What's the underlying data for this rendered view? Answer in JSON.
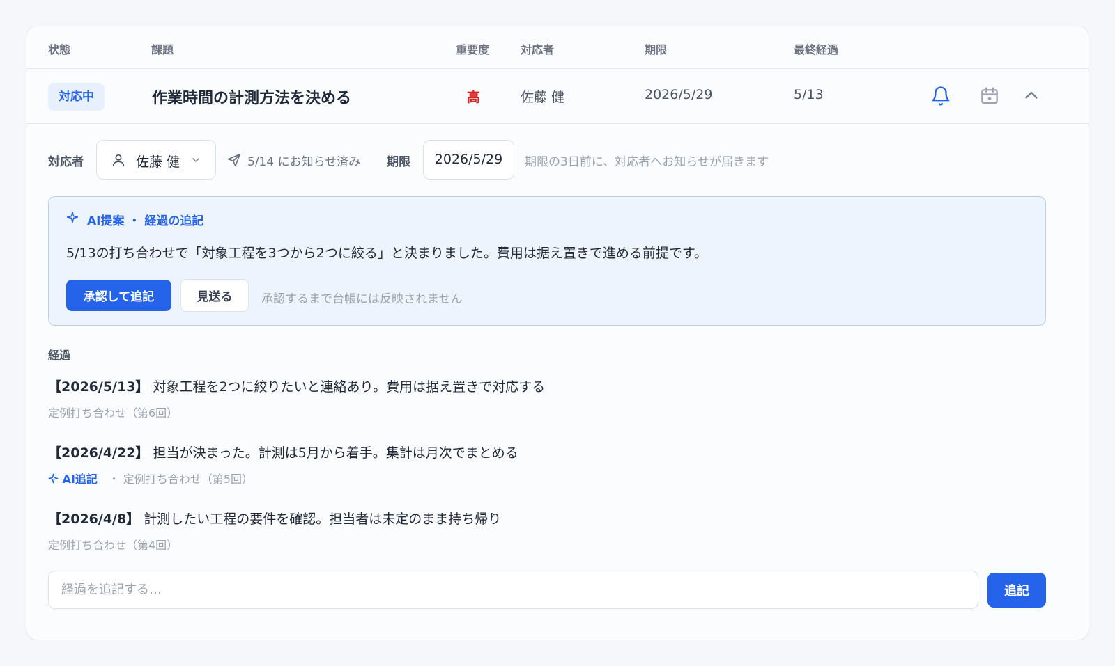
{
  "table": {
    "headers": {
      "status": "状態",
      "issue": "課題",
      "priority": "重要度",
      "assignee": "対応者",
      "due": "期限",
      "last_progress": "最終経過"
    },
    "row": {
      "status": "対応中",
      "title": "作業時間の計測方法を決める",
      "priority": "高",
      "assignee": "佐藤 健",
      "due": "2026/5/29",
      "last_progress": "5/13"
    }
  },
  "detail": {
    "assignee_label": "対応者",
    "assignee_value": "佐藤 健",
    "notified": "5/14 にお知らせ済み",
    "due_label": "期限",
    "due_value": "2026/5/29",
    "due_hint": "期限の3日前に、対応者へお知らせが届きます"
  },
  "ai_suggestion": {
    "heading": "AI提案 ・ 経過の追記",
    "text": "5/13の打ち合わせで「対象工程を3つから2つに絞る」と決まりました。費用は据え置きで進める前提です。",
    "approve_label": "承認して追記",
    "skip_label": "見送る",
    "note": "承認するまで台帳には反映されません"
  },
  "progress": {
    "section_label": "経過",
    "entries": [
      {
        "date": "【2026/5/13】",
        "text": "対象工程を2つに絞りたいと連絡あり。費用は据え置きで対応する",
        "meta": "定例打ち合わせ（第6回）",
        "ai_tag": ""
      },
      {
        "date": "【2026/4/22】",
        "text": "担当が決まった。計測は5月から着手。集計は月次でまとめる",
        "meta": "・ 定例打ち合わせ（第5回）",
        "ai_tag": "AI追記"
      },
      {
        "date": "【2026/4/8】",
        "text": "計測したい工程の要件を確認。担当者は未定のまま持ち帰り",
        "meta": "定例打ち合わせ（第4回）",
        "ai_tag": ""
      }
    ],
    "input_placeholder": "経過を追記する…",
    "add_label": "追記"
  },
  "colors": {
    "accent": "#2563eb",
    "priority_high": "#dc2626",
    "ai_box_bg": "#eef4fd"
  }
}
